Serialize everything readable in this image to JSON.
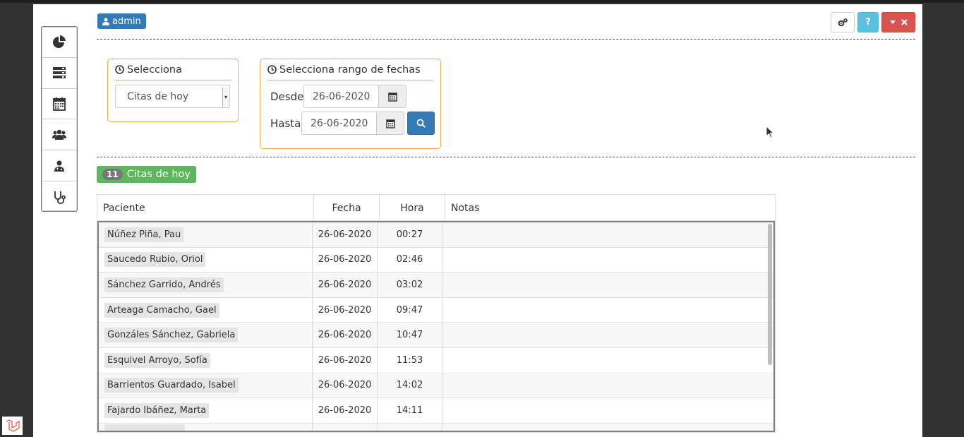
{
  "header": {
    "user_label": "admin",
    "help_label": "?"
  },
  "sidebar": {
    "items": [
      {
        "icon": "pie-chart-icon"
      },
      {
        "icon": "server-icon"
      },
      {
        "icon": "calendar-icon"
      },
      {
        "icon": "users-icon"
      },
      {
        "icon": "user-md-icon"
      },
      {
        "icon": "stethoscope-icon"
      }
    ]
  },
  "filter_select": {
    "legend": "Selecciona",
    "selected": "Citas de hoy"
  },
  "date_range": {
    "legend": "Selecciona rango de fechas",
    "from_label": "Desde",
    "from_value": "26-06-2020",
    "to_label": "Hasta",
    "to_value": "26-06-2020"
  },
  "results": {
    "count": "11",
    "label": "Citas de hoy"
  },
  "table": {
    "columns": [
      "Paciente",
      "Fecha",
      "Hora",
      "Notas"
    ],
    "rows": [
      {
        "paciente": "Núñez Piña, Pau",
        "fecha": "26-06-2020",
        "hora": "00:27",
        "notas": ""
      },
      {
        "paciente": "Saucedo Rubio, Oriol",
        "fecha": "26-06-2020",
        "hora": "02:46",
        "notas": ""
      },
      {
        "paciente": "Sánchez Garrido, Andrés",
        "fecha": "26-06-2020",
        "hora": "03:02",
        "notas": ""
      },
      {
        "paciente": "Arteaga Camacho, Gael",
        "fecha": "26-06-2020",
        "hora": "09:47",
        "notas": ""
      },
      {
        "paciente": "Gonzáles Sánchez, Gabriela",
        "fecha": "26-06-2020",
        "hora": "10:47",
        "notas": ""
      },
      {
        "paciente": "Esquivel Arroyo, Sofía",
        "fecha": "26-06-2020",
        "hora": "11:53",
        "notas": ""
      },
      {
        "paciente": "Barrientos Guardado, Isabel",
        "fecha": "26-06-2020",
        "hora": "14:02",
        "notas": ""
      },
      {
        "paciente": "Fajardo Ibáñez, Marta",
        "fecha": "26-06-2020",
        "hora": "14:11",
        "notas": ""
      }
    ]
  },
  "colors": {
    "primary": "#337ab7",
    "success": "#5cb85c",
    "info": "#5bc0de",
    "danger": "#d9534f",
    "warning_border": "#f0ad4e"
  }
}
